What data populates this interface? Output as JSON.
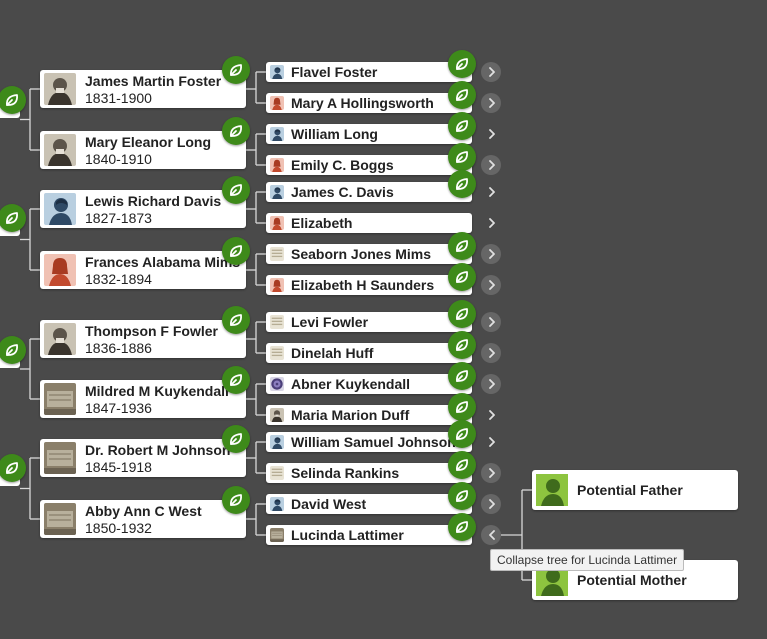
{
  "gen2": [
    {
      "name": "James Martin Foster",
      "dates": "1831-1900",
      "photo": "portrait-photo"
    },
    {
      "name": "Mary Eleanor Long",
      "dates": "1840-1910",
      "photo": "portrait-photo"
    },
    {
      "name": "Lewis Richard Davis",
      "dates": "1827-1873",
      "photo": "male-silhouette"
    },
    {
      "name": "Frances Alabama Mims",
      "dates": "1832-1894",
      "photo": "female-silhouette"
    },
    {
      "name": "Thompson F Fowler",
      "dates": "1836-1886",
      "photo": "portrait-photo"
    },
    {
      "name": "Mildred M Kuykendall",
      "dates": "1847-1936",
      "photo": "gravestone-photo"
    },
    {
      "name": "Dr. Robert M Johnson",
      "dates": "1845-1918",
      "photo": "gravestone-photo"
    },
    {
      "name": "Abby Ann C West",
      "dates": "1850-1932",
      "photo": "gravestone-photo"
    }
  ],
  "gen3": [
    {
      "name": "Flavel Foster",
      "photo": "male-silhouette",
      "hint": true,
      "arrow": "circle"
    },
    {
      "name": "Mary A Hollingsworth",
      "photo": "female-silhouette",
      "hint": true,
      "arrow": "circle"
    },
    {
      "name": "William Long",
      "photo": "male-silhouette",
      "hint": true,
      "arrow": "plain"
    },
    {
      "name": "Emily C. Boggs",
      "photo": "female-silhouette",
      "hint": true,
      "arrow": "circle"
    },
    {
      "name": "James C. Davis",
      "photo": "male-silhouette",
      "hint": true,
      "arrow": "plain"
    },
    {
      "name": "Elizabeth",
      "photo": "female-silhouette",
      "hint": false,
      "arrow": "plain"
    },
    {
      "name": "Seaborn Jones Mims",
      "photo": "document-photo",
      "hint": true,
      "arrow": "circle"
    },
    {
      "name": "Elizabeth H Saunders",
      "photo": "female-silhouette",
      "hint": true,
      "arrow": "circle"
    },
    {
      "name": "Levi Fowler",
      "photo": "document-photo",
      "hint": true,
      "arrow": "circle"
    },
    {
      "name": "Dinelah Huff",
      "photo": "document-photo",
      "hint": true,
      "arrow": "circle"
    },
    {
      "name": "Abner Kuykendall",
      "photo": "seal-photo",
      "hint": true,
      "arrow": "circle"
    },
    {
      "name": "Maria Marion Duff",
      "photo": "portrait-photo",
      "hint": true,
      "arrow": "plain"
    },
    {
      "name": "William Samuel Johnson",
      "photo": "male-silhouette",
      "hint": true,
      "arrow": "plain"
    },
    {
      "name": "Selinda Rankins",
      "photo": "document-photo",
      "hint": true,
      "arrow": "circle"
    },
    {
      "name": "David West",
      "photo": "male-silhouette",
      "hint": true,
      "arrow": "circle"
    },
    {
      "name": "Lucinda Lattimer",
      "photo": "gravestone-photo",
      "hint": true,
      "arrow": "collapse"
    }
  ],
  "potential": {
    "father": "Potential Father",
    "mother": "Potential Mother"
  },
  "tooltip": "Collapse tree for Lucinda Lattimer",
  "colors": {
    "background": "#4a4a4a",
    "hint_green": "#3e8a1a",
    "male_blue": "#b9cfe0",
    "female_red": "#f0c1b3",
    "potential_green": "#8dc43f"
  }
}
